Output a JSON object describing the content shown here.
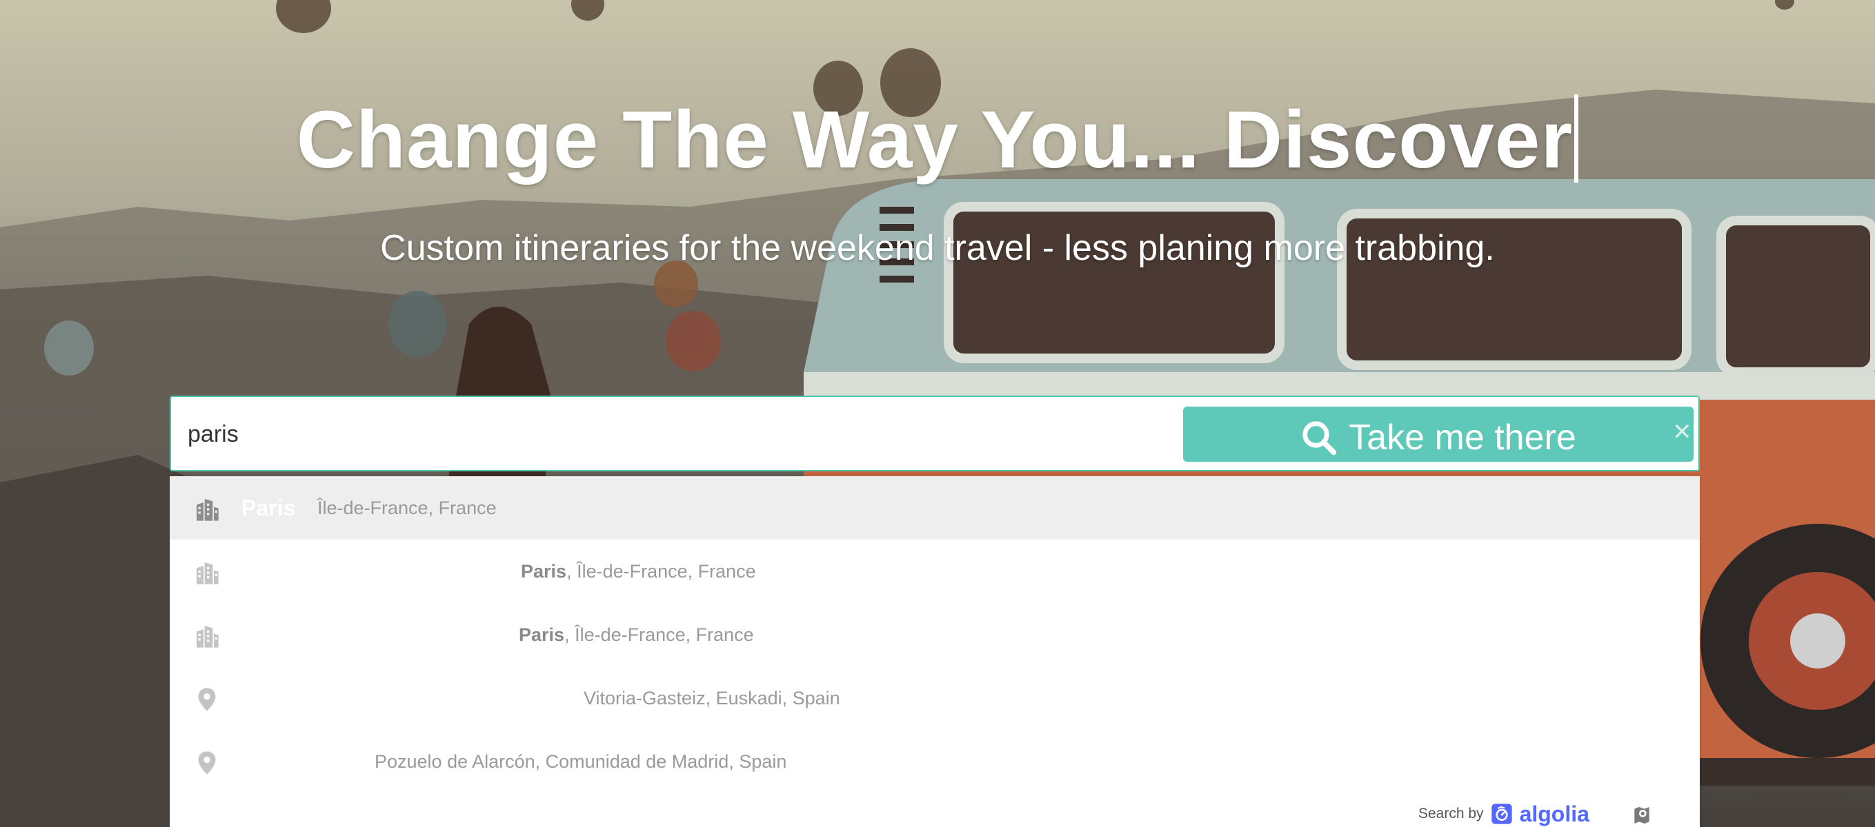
{
  "hero": {
    "headline": "Change The Way You... Discover",
    "subheadline": "Custom itineraries for the weekend travel - less planing more trabbing."
  },
  "search": {
    "value": "paris",
    "button_label": "Take me there",
    "button_icon": "search-icon",
    "clear_icon": "close-icon"
  },
  "suggestions": [
    {
      "icon": "city-icon",
      "name": "Paris",
      "detail": "Île-de-France, France"
    },
    {
      "icon": "city-icon",
      "name": "Paris",
      "detail": ", Île-de-France, France"
    },
    {
      "icon": "city-icon",
      "name": "Paris",
      "detail": ", Île-de-France, France"
    },
    {
      "icon": "pin-icon",
      "name": "",
      "detail": "Vitoria-Gasteiz, Euskadi, Spain"
    },
    {
      "icon": "pin-icon",
      "name": "",
      "detail": "Pozuelo de Alarcón, Comunidad de Madrid, Spain"
    }
  ],
  "footer": {
    "search_by": "Search by",
    "brand": "algolia"
  },
  "colors": {
    "accent": "#5ec9b9",
    "input_border": "#4fc4a4",
    "algolia": "#5468ff"
  }
}
